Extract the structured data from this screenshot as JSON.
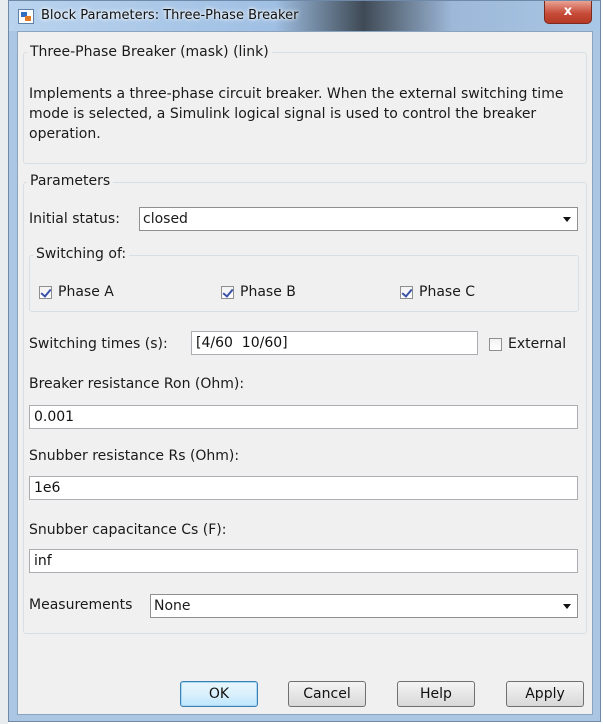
{
  "window": {
    "title": "Block Parameters: Three-Phase Breaker",
    "close_label": "x"
  },
  "mask": {
    "header": "Three-Phase Breaker (mask) (link)",
    "description": "Implements a three-phase circuit breaker. When the external switching time mode is selected, a Simulink logical signal is used to control the breaker operation."
  },
  "parameters": {
    "header": "Parameters",
    "initial_status_label": "Initial status:",
    "initial_status_value": "closed",
    "switching_of": {
      "header": "Switching of:",
      "phases": [
        {
          "label": "Phase A",
          "checked": true
        },
        {
          "label": "Phase B",
          "checked": true
        },
        {
          "label": "Phase C",
          "checked": true
        }
      ]
    },
    "switching_times_label": "Switching times (s):",
    "switching_times_value": "[4/60  10/60]",
    "external_label": "External",
    "external_checked": false,
    "ron_label": "Breaker resistance Ron (Ohm):",
    "ron_value": "0.001",
    "rs_label": "Snubber resistance Rs (Ohm):",
    "rs_value": "1e6",
    "cs_label": "Snubber capacitance Cs (F):",
    "cs_value": "inf",
    "measurements_label": "Measurements",
    "measurements_value": "None"
  },
  "buttons": {
    "ok": "OK",
    "cancel": "Cancel",
    "help": "Help",
    "apply": "Apply"
  }
}
